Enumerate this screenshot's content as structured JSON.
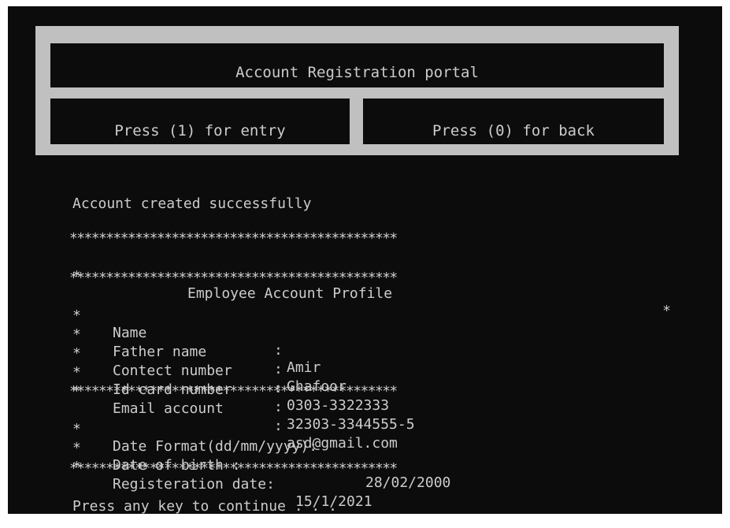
{
  "window": {
    "background": "#0c0c0c",
    "text_color": "#cccccc",
    "frame_color": "#c0c0c0"
  },
  "menu": {
    "title": "Account Registration portal",
    "entry_option": "Press (1) for entry",
    "back_option": "Press (0) for back"
  },
  "status_message": "Account created successfully",
  "separator": "*********************************************",
  "profile": {
    "border_char": "*",
    "heading": "Employee Account Profile",
    "fields": [
      {
        "label": "Name",
        "value": "Amir"
      },
      {
        "label": "Father name",
        "value": "Ghafoor"
      },
      {
        "label": "Contect number",
        "value": "0303-3322333"
      },
      {
        "label": "Id card number",
        "value": "32303-3344555-5"
      },
      {
        "label": "Email account",
        "value": "asd@gmail.com"
      }
    ],
    "dates": {
      "format_label": "Date Format(dd/mm/yyyy):",
      "birth_label": "Date of birth :",
      "birth_value": "28/02/2000",
      "registration_label": "Registeration date:",
      "registration_value": "15/1/2021"
    }
  },
  "prompt": "Press any key to continue . . ."
}
